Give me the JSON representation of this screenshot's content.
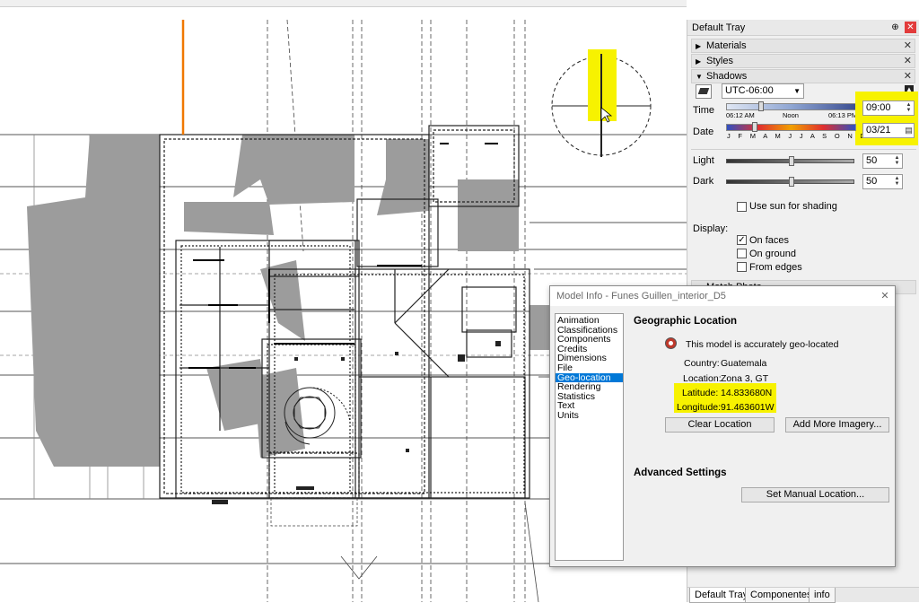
{
  "tray": {
    "title": "Default Tray",
    "pin_glyph": "⊕",
    "close_glyph": "✕",
    "panels": {
      "materials": "Materials",
      "styles": "Styles",
      "shadows": "Shadows"
    },
    "shadows": {
      "timezone": "UTC-06:00",
      "time_label": "Time",
      "date_label": "Date",
      "time_start": "06:12 AM",
      "time_noon": "Noon",
      "time_end": "06:13 PM",
      "months": "J F M A M J J A S O N D",
      "time_value": "09:00",
      "date_value": "03/21",
      "light_label": "Light",
      "light_value": "50",
      "dark_label": "Dark",
      "dark_value": "50",
      "use_sun_label": "Use sun for shading",
      "display_label": "Display:",
      "on_faces_label": "On faces",
      "on_faces_checked": true,
      "on_ground_label": "On ground",
      "from_edges_label": "From edges",
      "next_panel_partial": "Match Photo"
    },
    "bottom_tabs": [
      "Default Tray",
      "Componentes",
      "info"
    ]
  },
  "dialog": {
    "title": "Model Info - Funes Guillen_interior_D5",
    "close_glyph": "✕",
    "list": [
      "Animation",
      "Classifications",
      "Components",
      "Credits",
      "Dimensions",
      "File",
      "Geo-location",
      "Rendering",
      "Statistics",
      "Text",
      "Units"
    ],
    "selected_index": 6,
    "geo_heading": "Geographic Location",
    "geo_status": "This model is accurately geo-located",
    "country_label": "Country:",
    "country_value": "Guatemala",
    "location_label": "Location:",
    "location_value": "Zona 3, GT",
    "latitude_label": "Latitude:",
    "latitude_value": "14.833680N",
    "longitude_label": "Longitude:",
    "longitude_value": "91.463601W",
    "clear_btn": "Clear Location",
    "imagery_btn": "Add More Imagery...",
    "adv_heading": "Advanced Settings",
    "manual_btn": "Set Manual Location..."
  },
  "colors": {
    "highlight": "#f7f200",
    "selection": "#0078d7",
    "shadow_fill": "#9c9c9c",
    "axis_orange": "#f07800"
  }
}
